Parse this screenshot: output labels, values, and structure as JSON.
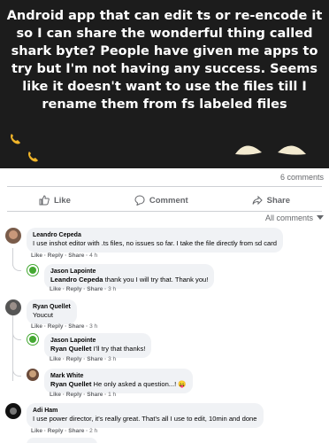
{
  "post": {
    "banner_text": "Android app that can edit ts or re-encode it so I can share the wonderful thing called shark byte? People have given me apps to try but I'm not having any success. Seems like it doesn't want to use the files till I rename them from fs labeled files",
    "banner_bg": "#1c1c1c",
    "comment_count": "6 comments"
  },
  "actions": {
    "like": "Like",
    "comment": "Comment",
    "share": "Share"
  },
  "filter_label": "All comments",
  "comments": [
    {
      "name": "Leandro Cepeda",
      "text": "I use inshot editor with .ts files, no issues so far. I take the file directly from sd card",
      "like": "Like",
      "reply": "Reply",
      "share": "Share",
      "time": "4 h"
    },
    {
      "name": "Jason Lapointe",
      "mention": "Leandro Cepeda",
      "text": " thank you I will try that. Thank you!",
      "like": "Like",
      "reply": "Reply",
      "share": "Share",
      "time": "3 h"
    },
    {
      "name": "Ryan Quellet",
      "text": "Youcut",
      "like": "Like",
      "reply": "Reply",
      "share": "Share",
      "time": "3 h"
    },
    {
      "name": "Jason Lapointe",
      "mention": "Ryan Quellet",
      "text": " I'll try that thanks!",
      "like": "Like",
      "reply": "Reply",
      "share": "Share",
      "time": "3 h"
    },
    {
      "name": "Mark White",
      "mention": "Ryan Quellet",
      "text": " He only asked a question...! 😛",
      "like": "Like",
      "reply": "Reply",
      "share": "Share",
      "time": "1 h"
    },
    {
      "name": "Adi Ham",
      "text": "I use power director, it's really great. That's all I use to edit, 10min and done",
      "like": "Like",
      "reply": "Reply",
      "share": "Share",
      "time": "2 h"
    }
  ]
}
